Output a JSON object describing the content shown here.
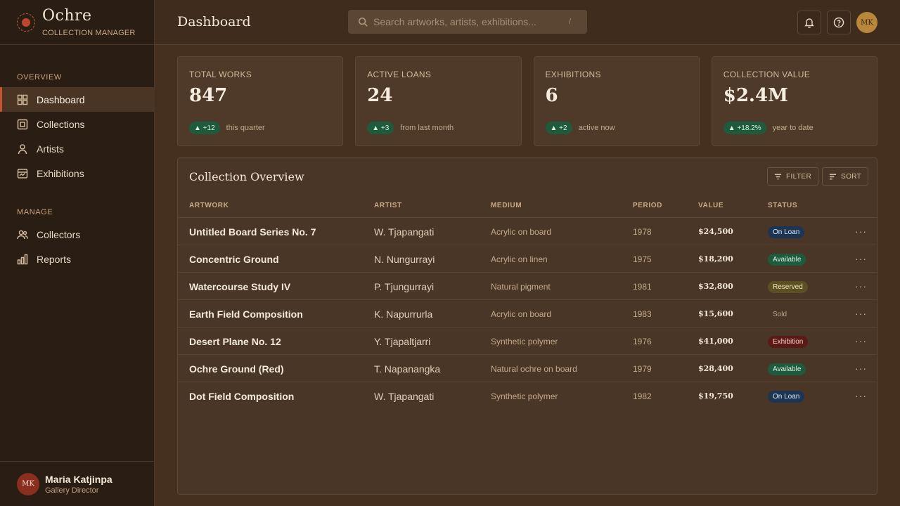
{
  "brand": {
    "name": "Ochre",
    "subtitle": "COLLECTION MANAGER"
  },
  "sidebar": {
    "sections": [
      {
        "title": "OVERVIEW",
        "items": [
          {
            "label": "Dashboard",
            "icon": "grid-icon",
            "active": true
          },
          {
            "label": "Collections",
            "icon": "frame-icon"
          },
          {
            "label": "Artists",
            "icon": "person-icon"
          },
          {
            "label": "Exhibitions",
            "icon": "gallery-icon"
          }
        ]
      },
      {
        "title": "MANAGE",
        "items": [
          {
            "label": "Collectors",
            "icon": "users-icon"
          },
          {
            "label": "Reports",
            "icon": "bar-chart-icon"
          }
        ]
      }
    ]
  },
  "user": {
    "initials": "MK",
    "name": "Maria Katjinpa",
    "role": "Gallery Director"
  },
  "header": {
    "title": "Dashboard",
    "search_placeholder": "Search artworks, artists, exhibitions...",
    "search_shortcut": "/",
    "avatar_initials": "MK"
  },
  "stats": [
    {
      "label": "TOTAL WORKS",
      "value": "847",
      "trend": "▲ +12",
      "note": "this quarter"
    },
    {
      "label": "ACTIVE LOANS",
      "value": "24",
      "trend": "▲ +3",
      "note": "from last month"
    },
    {
      "label": "EXHIBITIONS",
      "value": "6",
      "trend": "▲ +2",
      "note": "active now"
    },
    {
      "label": "COLLECTION VALUE",
      "value": "$2.4M",
      "trend": "▲ +18.2%",
      "note": "year to date"
    }
  ],
  "table": {
    "title": "Collection Overview",
    "filter_label": "FILTER",
    "sort_label": "SORT",
    "columns": [
      "ARTWORK",
      "ARTIST",
      "MEDIUM",
      "PERIOD",
      "VALUE",
      "STATUS"
    ],
    "rows": [
      {
        "artwork": "Untitled Board Series No. 7",
        "artist": "W. Tjapangati",
        "medium": "Acrylic on board",
        "period": "1978",
        "value": "$24,500",
        "status": "On Loan",
        "status_type": "loan"
      },
      {
        "artwork": "Concentric Ground",
        "artist": "N. Nungurrayi",
        "medium": "Acrylic on linen",
        "period": "1975",
        "value": "$18,200",
        "status": "Available",
        "status_type": "avail"
      },
      {
        "artwork": "Watercourse Study IV",
        "artist": "P. Tjungurrayi",
        "medium": "Natural pigment",
        "period": "1981",
        "value": "$32,800",
        "status": "Reserved",
        "status_type": "reserved"
      },
      {
        "artwork": "Earth Field Composition",
        "artist": "K. Napurrurla",
        "medium": "Acrylic on board",
        "period": "1983",
        "value": "$15,600",
        "status": "Sold",
        "status_type": "sold"
      },
      {
        "artwork": "Desert Plane No. 12",
        "artist": "Y. Tjapaltjarri",
        "medium": "Synthetic polymer",
        "period": "1976",
        "value": "$41,000",
        "status": "Exhibition",
        "status_type": "exhib"
      },
      {
        "artwork": "Ochre Ground (Red)",
        "artist": "T. Napanangka",
        "medium": "Natural ochre on board",
        "period": "1979",
        "value": "$28,400",
        "status": "Available",
        "status_type": "avail"
      },
      {
        "artwork": "Dot Field Composition",
        "artist": "W. Tjapangati",
        "medium": "Synthetic polymer",
        "period": "1982",
        "value": "$19,750",
        "status": "On Loan",
        "status_type": "loan"
      }
    ]
  }
}
